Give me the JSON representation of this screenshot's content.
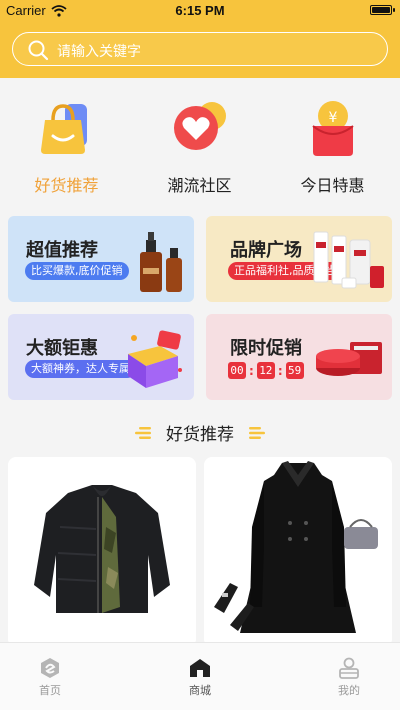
{
  "status_bar": {
    "carrier": "Carrier",
    "time": "6:15 PM",
    "battery_level": 1.0
  },
  "search": {
    "placeholder": "请输入关键字",
    "icon": "search-icon"
  },
  "categories": [
    {
      "label": "好货推荐",
      "icon": "shopping-bag-icon",
      "active": true
    },
    {
      "label": "潮流社区",
      "icon": "heart-chat-icon",
      "active": false
    },
    {
      "label": "今日特惠",
      "icon": "red-envelope-icon",
      "active": false
    }
  ],
  "promos": [
    {
      "title": "超值推荐",
      "tag": "比买爆款,底价促销",
      "background": "#cfe3f8",
      "tag_color": "#4d7cf0"
    },
    {
      "title": "品牌广场",
      "tag": "正品福利社,品质担当",
      "background": "#f7e9c4",
      "tag_color": "#e8323c"
    },
    {
      "title": "大额钜惠",
      "tag": "大额神券，达人专属",
      "background": "#dfe1f7",
      "tag_color": "#5b6ff0"
    },
    {
      "title": "限时促销",
      "background": "#f6dfe2",
      "countdown": {
        "hours": "00",
        "minutes": "12",
        "seconds": "59"
      }
    }
  ],
  "section_title": "好货推荐",
  "products": [
    {
      "name": "black-puffer-jacket"
    },
    {
      "name": "black-wool-coat"
    }
  ],
  "tabbar": [
    {
      "label": "首页",
      "icon": "home-logo-icon",
      "active": false
    },
    {
      "label": "商城",
      "icon": "store-icon",
      "active": true
    },
    {
      "label": "我的",
      "icon": "profile-icon",
      "active": false
    }
  ],
  "colors": {
    "accent": "#f7c43d",
    "active_category": "#f0a23a",
    "price_red": "#e8323c"
  }
}
